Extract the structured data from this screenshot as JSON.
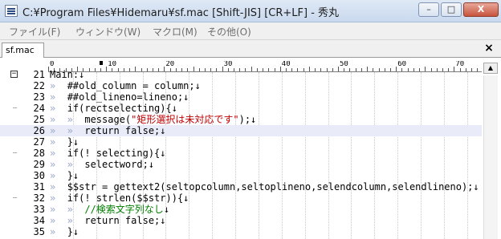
{
  "window": {
    "title": "C:¥Program Files¥Hidemaru¥sf.mac  [Shift-JIS] [CR+LF] - 秀丸",
    "min_label": "–",
    "max_label": "□",
    "close_label": "X"
  },
  "menu": {
    "items": [
      "ファイル(F)",
      "ウィンドウ(W)",
      "マクロ(M)",
      "その他(O)"
    ]
  },
  "tabs": [
    {
      "label": "sf.mac"
    }
  ],
  "tab_close": "×",
  "ruler": {
    "labels": [
      "0",
      "10",
      "20",
      "30",
      "40",
      "50",
      "60",
      "70"
    ]
  },
  "editor": {
    "current_line": 26,
    "lines": [
      {
        "num": "21",
        "fold": "⊟",
        "indent": "",
        "text": "Main:↓"
      },
      {
        "num": "22",
        "fold": "",
        "indent": "»  ",
        "text": "##old_column = column;↓"
      },
      {
        "num": "23",
        "fold": "",
        "indent": "»  ",
        "text": "##old_lineno=lineno;↓"
      },
      {
        "num": "24",
        "fold": "–",
        "indent": "»  ",
        "text": "if(rectselecting){↓"
      },
      {
        "num": "25",
        "fold": "",
        "indent": "»  »  ",
        "text": "message(\"矩形選択は未対応です\");↓"
      },
      {
        "num": "26",
        "fold": "",
        "indent": "»  »  ",
        "text": "return false;↓"
      },
      {
        "num": "27",
        "fold": "",
        "indent": "»  ",
        "text": "}↓"
      },
      {
        "num": "28",
        "fold": "–",
        "indent": "»  ",
        "text": "if(! selecting){↓"
      },
      {
        "num": "29",
        "fold": "",
        "indent": "»  »  ",
        "text": "selectword;↓"
      },
      {
        "num": "30",
        "fold": "",
        "indent": "»  ",
        "text": "}↓"
      },
      {
        "num": "31",
        "fold": "",
        "indent": "»  ",
        "text": "$$str = gettext2(seltopcolumn,seltoplineno,selendcolumn,selendlineno);↓"
      },
      {
        "num": "32",
        "fold": "–",
        "indent": "»  ",
        "text": "if(! strlen($$str)){↓"
      },
      {
        "num": "33",
        "fold": "",
        "indent": "»  »  ",
        "text": "//検索文字列なし↓"
      },
      {
        "num": "34",
        "fold": "",
        "indent": "»  »  ",
        "text": "return false;↓"
      },
      {
        "num": "35",
        "fold": "",
        "indent": "»  ",
        "text": "}↓"
      }
    ]
  },
  "colors": {
    "string": "#c00000",
    "comment": "#008000",
    "tab_mark": "#9aa8c8",
    "current_line_bg": "#e9ecf8"
  }
}
